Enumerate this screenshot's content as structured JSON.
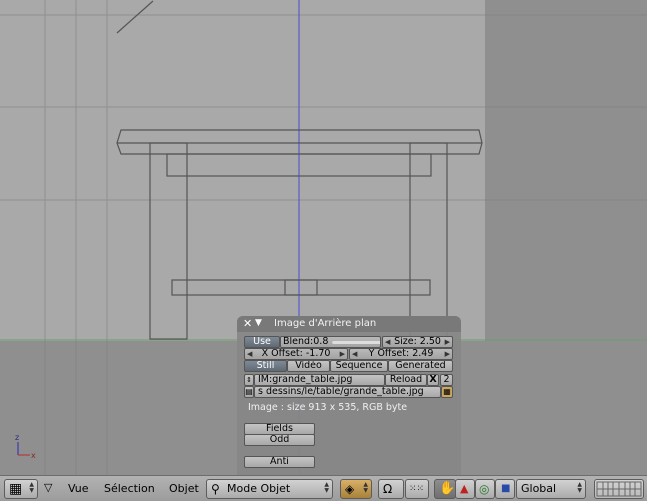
{
  "viewport": {
    "background_color": "#8f8f8f",
    "image_color": "#a9a9a9",
    "grid_color": "#7d7d7d",
    "y_axis_color": "#4b4bd2",
    "x_axis_color": "#6aa06a"
  },
  "panel": {
    "title": "Image d'Arrière plan",
    "use_label": "Use",
    "blend": {
      "label": "Blend:0.8",
      "value": 0.8
    },
    "size_label": "Size: 2.50",
    "x_offset_label": "X Offset: -1.70",
    "y_offset_label": "Y Offset: 2.49",
    "source_tabs": [
      "Still",
      "Vidéo",
      "Sequence",
      "Generated"
    ],
    "active_source": "Still",
    "image_name": "IM:grande_table.jpg",
    "reload_label": "Reload",
    "x_label": "X",
    "users_count": "2",
    "image_path": "s dessins/le/table/grande_table.jpg",
    "info_text": "Image : size 913 x 535, RGB byte",
    "fields_label": "Fields",
    "odd_label": "Odd",
    "anti_label": "Anti"
  },
  "axis_indicator": {
    "z_label": "z",
    "x_label": "x"
  },
  "header": {
    "menus": [
      "Vue",
      "Sélection",
      "Objet"
    ],
    "mode_label": "Mode Objet",
    "orientation_label": "Global"
  }
}
